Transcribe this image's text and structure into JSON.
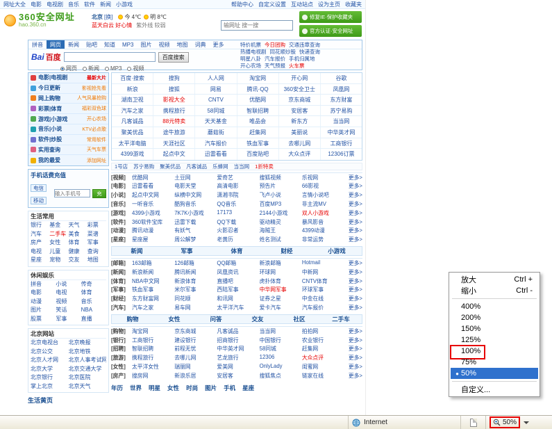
{
  "labels": {
    "more": "更多>"
  },
  "colors": {
    "annotation": "#e60000",
    "selection": "#2f71cd",
    "link": "#2353a4",
    "logo_green": "#3f9d1c"
  },
  "topnav": {
    "left": [
      "网址大全",
      "电影",
      "电视剧",
      "音乐",
      "软件",
      "新闻",
      "小游戏"
    ],
    "right": [
      "帮助中心",
      "自定义设置",
      "互动站点",
      "设为主页",
      "收藏夹"
    ]
  },
  "header": {
    "logo_title": "360安全网址",
    "logo_sub": "hao.360.cn",
    "city": "北京",
    "city_link": "[换]",
    "weather": [
      "今 4℃",
      "明 8℃"
    ],
    "weather_extra": "紫外线 较弱",
    "weather_tip": "蓝天白云 好心情",
    "url_placeholder": "输网址 搜一搜",
    "promos": [
      "修复IE·保护收藏夹",
      "官方认证·安全网址"
    ]
  },
  "search": {
    "brand_a": "Bai",
    "brand_b": "百度",
    "tabs": [
      {
        "$": "拼音"
      },
      {
        "$": "网页",
        "active": true
      },
      {
        "$": "新闻"
      },
      {
        "$": "贴吧"
      },
      {
        "$": "知道"
      },
      {
        "$": "MP3"
      },
      {
        "$": "图片"
      },
      {
        "$": "视频"
      },
      {
        "$": "地图"
      },
      {
        "$": "词典"
      },
      {
        "$": "更多"
      }
    ],
    "button": "百度搜索",
    "options": [
      {
        "$": "网页",
        "on": true
      },
      {
        "$": "新闻"
      },
      {
        "$": "MP3"
      },
      {
        "$": "视频"
      }
    ],
    "hot_lines": [
      [
        "特价机票",
        {
          "$": "今日团购",
          "red": true
        },
        "交通违章查询"
      ],
      [
        "热播电视剧",
        "同花顺炒股",
        "快递查询"
      ],
      [
        "明星八卦",
        "汽车报价",
        "手机归属地"
      ],
      [
        "开心农场",
        "天气预报",
        {
          "$": "火车票",
          "red": true
        }
      ]
    ]
  },
  "sidebar_menu": [
    {
      "icon_style": "background:#e04040",
      "title": "电影|电视剧",
      "badge": "最新大片",
      "red": true
    },
    {
      "icon_style": "background:#3fa0dc",
      "title": "今日更新",
      "badge": "影视抢先看"
    },
    {
      "icon_style": "background:#f08020",
      "title": "网上购物",
      "badge": "人气风暴抢购"
    },
    {
      "icon_style": "background:#b060c0",
      "title": "彩票|体育",
      "badge": "福彩双色球"
    },
    {
      "icon_style": "background:#50a850",
      "title": "游戏|小游戏",
      "badge": "开心农场"
    },
    {
      "icon_style": "background:#20a0b0",
      "title": "音乐|小说",
      "badge": "KTV必点歌"
    },
    {
      "icon_style": "background:#7070d0",
      "title": "软件|炒股",
      "badge": "常用软件"
    },
    {
      "icon_style": "background:#e06080",
      "title": "实用查询",
      "badge": "天气车票"
    },
    {
      "icon_style": "background:#f0b000",
      "title": "我的最爱",
      "badge": "添加网址"
    }
  ],
  "phone_box": {
    "title": "手机话费充值",
    "tabs": [
      "电信",
      "移动"
    ],
    "placeholder": "输入手机号",
    "button": "充值"
  },
  "life_box": {
    "title": "生活常用",
    "rows": [
      [
        "银行",
        "基金",
        "天气",
        "彩票"
      ],
      [
        "汽车",
        {
          "$": "二手车",
          "red": true
        },
        "美食",
        "菜谱"
      ],
      [
        "房产",
        "女性",
        "体育",
        "军事"
      ],
      [
        "电视",
        "儿童",
        "健康",
        "查询"
      ],
      [
        "星座",
        "宠物",
        "交友",
        "地图"
      ]
    ]
  },
  "fun_box": {
    "title": "休闲娱乐",
    "rows": [
      [
        "拼音",
        "小说",
        "传奇"
      ],
      [
        "电影",
        "电视",
        "体育"
      ],
      [
        "动漫",
        "视频",
        "音乐"
      ],
      [
        "图片",
        "笑话",
        "NBA"
      ],
      [
        "股票",
        "军事",
        "直播"
      ]
    ]
  },
  "city_box": {
    "title": "北京网站",
    "rows": [
      [
        "北京电视台",
        "北京晚报"
      ],
      [
        "北京公交",
        "北京地铁"
      ],
      [
        "北京人才网",
        "北京人事考试网"
      ],
      [
        "北京大学",
        "北京交通大学"
      ],
      [
        "北京银行",
        "北京医院"
      ],
      [
        "掌上北京",
        "北京天气"
      ]
    ]
  },
  "side_footer": "生活黄页",
  "sites": {
    "rows": [
      [
        "百度·搜索",
        "搜狗",
        "人人网",
        "淘宝网",
        "开心网",
        "谷歌"
      ],
      [
        "新浪",
        "搜狐",
        "网易",
        "腾讯·QQ",
        "360安全卫士",
        "凤凰网"
      ],
      [
        "湖南卫视",
        {
          "$": "影视大全",
          "red": true
        },
        "CNTV",
        "优酷网",
        "京东商城",
        "东方财富"
      ],
      [
        "汽车之家",
        "携程旅行",
        "58同城",
        "智联招聘",
        "安居客",
        "苏宁易购"
      ],
      [
        "凡客诚品",
        {
          "$": "88元特卖",
          "red": true
        },
        "天天基金",
        "唯品会",
        "新东方",
        "当当网"
      ],
      [
        "聚美优品",
        "途牛旅游",
        "蘑菇街",
        "赶集网",
        "美丽说",
        "中华英才网"
      ],
      [
        "太平洋电脑",
        "天涯社区",
        "汽车报价",
        "铁血军事",
        "去哪儿网",
        "工商银行"
      ],
      [
        "4399游戏",
        "起点中文",
        "迅雷看看",
        "百度贴吧",
        "大众点评",
        "12306订票"
      ]
    ]
  },
  "promo_strip": [
    "1号店",
    "苏宁易购",
    "聚美优品",
    "凡客诚品",
    "乐蜂网",
    "当当网",
    {
      "$": "1折特卖",
      "red": true
    }
  ],
  "cat1": {
    "rows": [
      {
        "tag": "[视频]",
        "links": [
          "优酷网",
          "土豆网",
          "爱奇艺",
          "搜狐视频",
          "乐视网"
        ]
      },
      {
        "tag": "[电影]",
        "links": [
          "迅雷看看",
          "电影天堂",
          "高清电影",
          "预告片",
          "66影视"
        ]
      },
      {
        "tag": "[小说]",
        "links": [
          "起点中文网",
          "纵横中文网",
          "潇湘书院",
          "飞卢小说",
          "言情小说吧"
        ]
      },
      {
        "tag": "[音乐]",
        "links": [
          "一听音乐",
          "酷狗音乐",
          "QQ音乐",
          "百度MP3",
          "非主流MV"
        ]
      },
      {
        "tag": "[游戏]",
        "links": [
          "4399小游戏",
          "7K7K小游戏",
          "17173",
          "2144小游戏",
          {
            "$": "双人小游戏",
            "red": true
          }
        ]
      },
      {
        "tag": "[软件]",
        "links": [
          "360软件宝库",
          "迅雷下载",
          "QQ下载",
          "驱动精灵",
          "暴风影音"
        ]
      },
      {
        "tag": "[动漫]",
        "links": [
          "腾讯动漫",
          "有妖气",
          "火影忍者",
          "海贼王",
          "4399动漫"
        ]
      },
      {
        "tag": "[星座]",
        "links": [
          "星座屋",
          "周公解梦",
          "老黄历",
          "姓名测试",
          "非常运势"
        ]
      }
    ]
  },
  "cat2": {
    "header": [
      "新闻",
      "军事",
      "体育",
      "财经",
      "小游戏"
    ],
    "rows": [
      {
        "tag": "[邮箱]",
        "links": [
          "163邮箱",
          "126邮箱",
          "QQ邮箱",
          "新浪邮箱",
          "Hotmail"
        ]
      },
      {
        "tag": "[新闻]",
        "links": [
          "新浪新闻",
          "腾讯新闻",
          "凤凰资讯",
          "环球网",
          "中新网"
        ]
      },
      {
        "tag": "[体育]",
        "links": [
          "NBA中文网",
          "新浪体育",
          "直播吧",
          "虎扑体育",
          "CNTV体育"
        ]
      },
      {
        "tag": "[军事]",
        "links": [
          "铁血军事",
          "米尔军事",
          "西陆军事",
          {
            "$": "中华网军事",
            "red": true
          },
          "环球军事"
        ]
      },
      {
        "tag": "[财经]",
        "links": [
          "东方财富网",
          "同花顺",
          "和讯网",
          "证券之星",
          "中金在线"
        ]
      },
      {
        "tag": "[汽车]",
        "links": [
          "汽车之家",
          "易车网",
          "太平洋汽车",
          "爱卡汽车",
          "汽车报价"
        ]
      }
    ]
  },
  "cat3": {
    "header": [
      "购物",
      "女性",
      "问答",
      "交友",
      "社区",
      "二手车"
    ],
    "rows": [
      {
        "tag": "[购物]",
        "links": [
          "淘宝网",
          "京东商城",
          "凡客诚品",
          "当当网",
          "拍拍网"
        ]
      },
      {
        "tag": "[银行]",
        "links": [
          "工商银行",
          "建设银行",
          "招商银行",
          "中国银行",
          "农业银行"
        ]
      },
      {
        "tag": "[招聘]",
        "links": [
          "智联招聘",
          "前程无忧",
          "中华英才网",
          "58同城",
          "赶集网"
        ]
      },
      {
        "tag": "[旅游]",
        "links": [
          "携程旅行",
          "去哪儿网",
          "艺龙旅行",
          "12306",
          {
            "$": "大众点评",
            "red": true
          }
        ]
      },
      {
        "tag": "[女性]",
        "links": [
          "太平洋女性",
          "瑞丽网",
          "爱美网",
          "OnlyLady",
          "闺蜜网"
        ]
      },
      {
        "tag": "[房产]",
        "links": [
          "搜房网",
          "新浪乐居",
          "安居客",
          "搜狐焦点",
          "链家在线"
        ]
      }
    ]
  },
  "footer_tabs": [
    "年历",
    "世界",
    "明星",
    "女性",
    "时尚",
    "图片",
    "手机",
    "星座"
  ],
  "context_menu": {
    "items": [
      {
        "label": "放大",
        "shortcut": "Ctrl +"
      },
      {
        "label": "缩小",
        "shortcut": "Ctrl -"
      },
      {
        "sep": true
      },
      {
        "label": "400%"
      },
      {
        "label": "200%"
      },
      {
        "label": "150%"
      },
      {
        "label": "125%"
      },
      {
        "label": "100%",
        "annotated": true
      },
      {
        "label": "75%"
      },
      {
        "label": "50%",
        "selected": true
      },
      {
        "sep": true
      },
      {
        "label": "自定义..."
      }
    ]
  },
  "statusbar": {
    "zone": "Internet",
    "zoom": "50%"
  }
}
